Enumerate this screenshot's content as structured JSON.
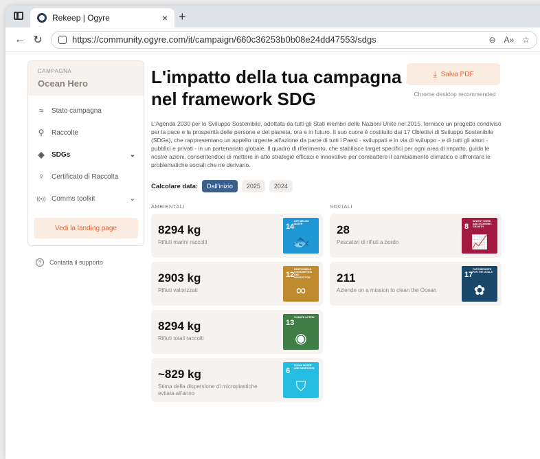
{
  "browser": {
    "tab_title": "Rekeep | Ogyre",
    "tab_close": "×",
    "new_tab": "+",
    "url": "https://community.ogyre.com/it/campaign/660c36253b0b08e24dd47553/sdgs",
    "icons": [
      "tab-strip-icon",
      "back-icon",
      "reload-icon",
      "lock-icon",
      "zoom-icon",
      "read-aloud-icon",
      "favorite-icon"
    ]
  },
  "sidebar": {
    "campaign_label": "CAMPAGNA",
    "campaign_name": "Ocean Hero",
    "items": [
      {
        "label": "Stato campagna",
        "icon": "≈"
      },
      {
        "label": "Raccolte",
        "icon": "⚲"
      },
      {
        "label": "SDGs",
        "icon": "◈",
        "chev": "⌄"
      },
      {
        "label": "Certificato di Raccolta",
        "icon": "♀"
      },
      {
        "label": "Comms toolkit",
        "icon": "((•))",
        "chev": "⌄"
      }
    ],
    "landing_button": "Vedi la landing page",
    "support_link": "Contatta il supporto"
  },
  "main": {
    "title": "L'impatto della tua campagna nel framework SDG",
    "pdf_button": "Salva PDF",
    "chrome_note": "Chrome desktop recommended",
    "description": "L'Agenda 2030 per lo Sviluppo Sostenibile, adottata da tutti gli Stati membri delle Nazioni Unite nel 2015, fornisce un progetto condiviso per la pace e la prosperità delle persone e del pianeta, ora e in futuro. Il suo cuore è costituito dai 17 Obiettivi di Sviluppo Sostenibile (SDGs), che rappresentano un appello urgente all'azione da parte di tutti i Paesi - sviluppati e in via di sviluppo - e di tutti gli attori - pubblici e privati - in un partenariato globale. Il quadro di riferimento, che stabilisce target specifici per ogni area di impatto, guida le nostre azioni, consentendoci di mettere in atto strategie efficaci e innovative per combattere il cambiamento climatico e affrontare le problematiche sociali che ne derivano.",
    "calc_label": "Calcolare data:",
    "filters": [
      "Dall'inizio",
      "2025",
      "2024"
    ],
    "selected_filter": "Dall'inizio",
    "ambientali_title": "AMBIENTALI",
    "sociali_title": "SOCIALI",
    "ambientali": [
      {
        "value": "8294 kg",
        "caption": "Rifiuti marini raccolti",
        "sdg_num": "14",
        "sdg_text": "LIFE BELOW WATER",
        "sdg_color": "#1f97d4",
        "sdg_glyph": "🐟"
      },
      {
        "value": "2903 kg",
        "caption": "Rifiuti valorizzati",
        "sdg_num": "12",
        "sdg_text": "RESPONSIBLE CONSUMPTION AND PRODUCTION",
        "sdg_color": "#bf8b2e",
        "sdg_glyph": "∞"
      },
      {
        "value": "8294 kg",
        "caption": "Rifiuti totali raccolti",
        "sdg_num": "13",
        "sdg_text": "CLIMATE ACTION",
        "sdg_color": "#3f7e44",
        "sdg_glyph": "◉"
      },
      {
        "value": "~829 kg",
        "caption": "Stima della dispersione di microplastiche evitata all'anno",
        "sdg_num": "6",
        "sdg_text": "CLEAN WATER AND SANITATION",
        "sdg_color": "#26bde2",
        "sdg_glyph": "⛉"
      }
    ],
    "sociali": [
      {
        "value": "28",
        "caption": "Pescatori di rifiuti a bordo",
        "sdg_num": "8",
        "sdg_text": "DECENT WORK AND ECONOMIC GROWTH",
        "sdg_color": "#a21942",
        "sdg_glyph": "📈"
      },
      {
        "value": "211",
        "caption": "Aziende on a mission to clean the Ocean",
        "sdg_num": "17",
        "sdg_text": "PARTNERSHIPS FOR THE GOALS",
        "sdg_color": "#19486a",
        "sdg_glyph": "✿"
      }
    ]
  }
}
